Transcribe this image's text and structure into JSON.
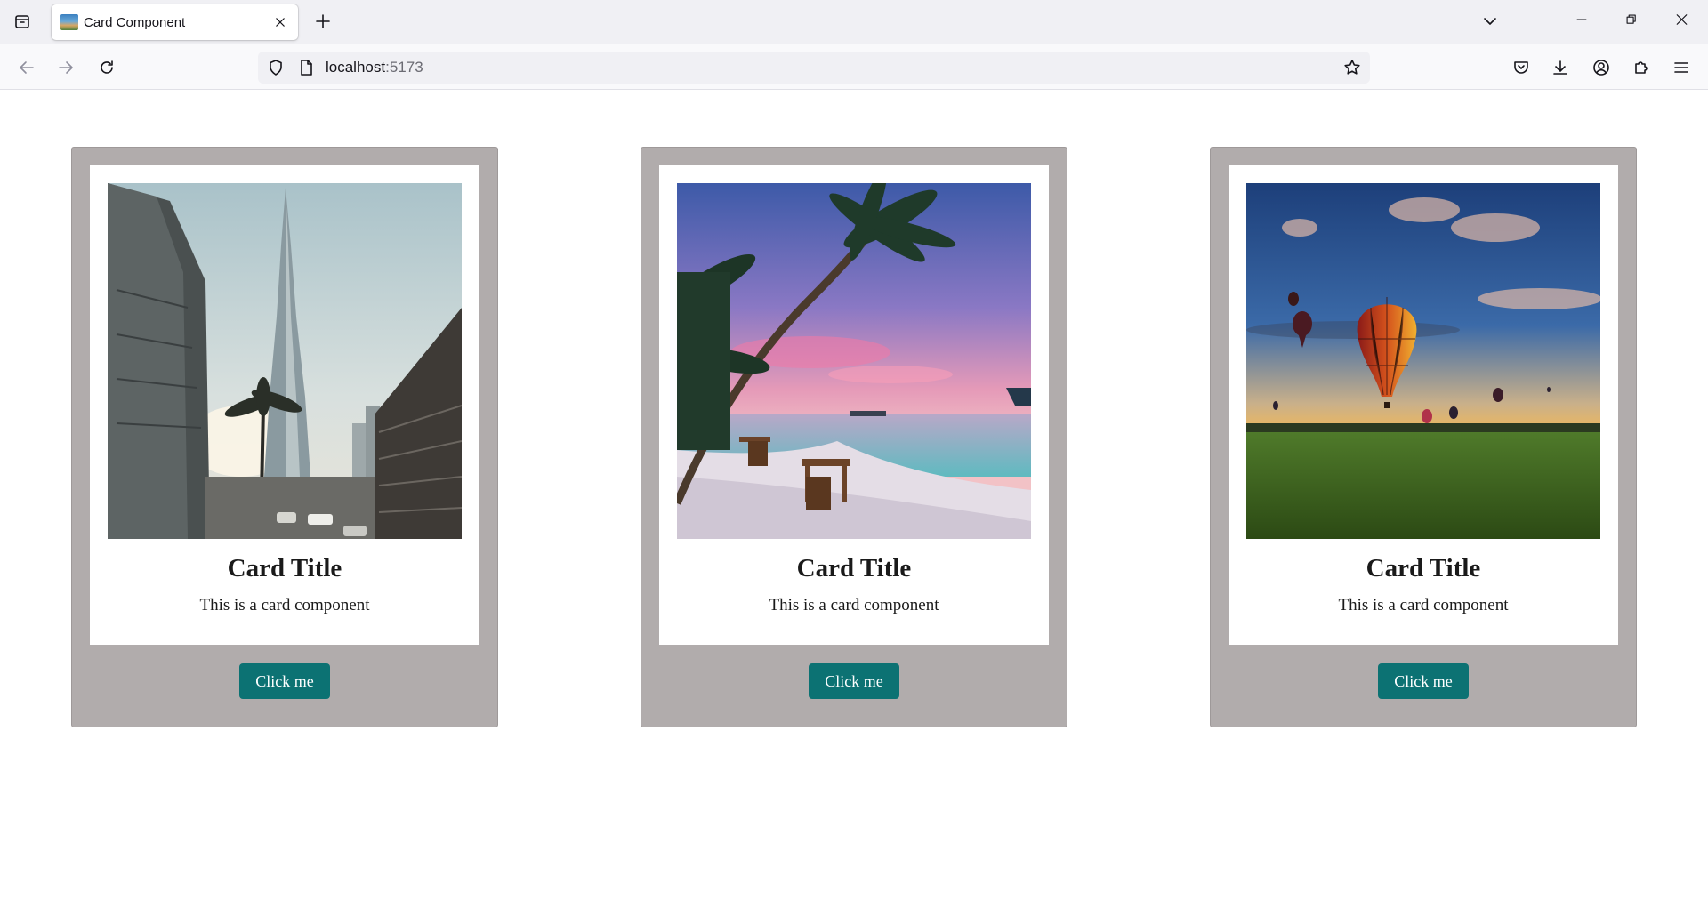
{
  "browser": {
    "tab": {
      "title": "Card Component"
    },
    "url": {
      "host": "localhost",
      "port": ":5173"
    }
  },
  "icons": {
    "tab_list": "folder-tabs-icon",
    "close": "close-icon",
    "new_tab": "plus-icon",
    "list_all_tabs": "chevron-down-icon",
    "minimize": "minimize-icon",
    "maximize": "restore-icon",
    "window_close": "close-icon",
    "back": "arrow-left-icon",
    "forward": "arrow-right-icon",
    "reload": "reload-icon",
    "shield": "shield-icon",
    "page": "page-icon",
    "bookmark": "star-icon",
    "pocket": "pocket-icon",
    "downloads": "download-icon",
    "account": "account-icon",
    "extensions": "puzzle-icon",
    "menu": "hamburger-menu-icon"
  },
  "colors": {
    "card_background": "#b1acac",
    "button_background": "#0c7273",
    "button_text": "#ffffff"
  },
  "cards": [
    {
      "title": "Card Title",
      "text": "This is a card component",
      "button": "Click me",
      "image": "city-skyscraper-photo"
    },
    {
      "title": "Card Title",
      "text": "This is a card component",
      "button": "Click me",
      "image": "beach-sunset-palm-photo"
    },
    {
      "title": "Card Title",
      "text": "This is a card component",
      "button": "Click me",
      "image": "hot-air-balloons-photo"
    }
  ]
}
